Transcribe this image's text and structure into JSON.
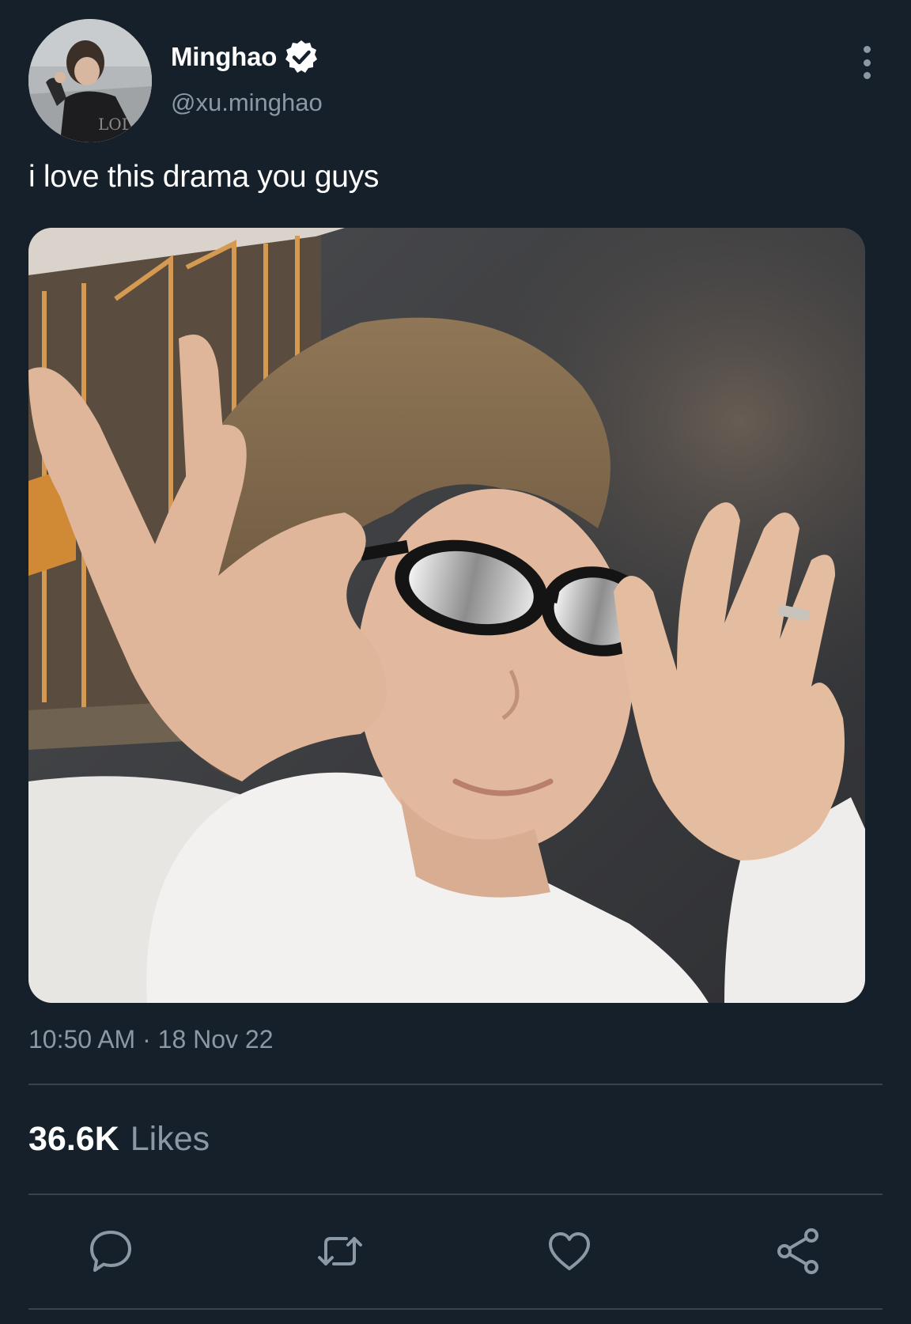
{
  "author": {
    "display_name": "Minghao",
    "handle": "@xu.minghao",
    "verified": true,
    "avatar_icon": "profile-photo"
  },
  "tweet": {
    "text": "i love this drama you guys",
    "media_icon": "photo-person-adjusting-glasses",
    "timestamp": "10:50 AM · 18 Nov 22"
  },
  "stats": {
    "likes_count": "36.6K",
    "likes_label": "Likes"
  },
  "actions": [
    {
      "name": "reply",
      "icon": "reply-icon"
    },
    {
      "name": "retweet",
      "icon": "retweet-icon"
    },
    {
      "name": "like",
      "icon": "heart-icon"
    },
    {
      "name": "share",
      "icon": "share-icon"
    }
  ],
  "colors": {
    "background": "#15202b",
    "text_primary": "#ffffff",
    "text_secondary": "#8b98a5",
    "divider": "#38444d"
  }
}
